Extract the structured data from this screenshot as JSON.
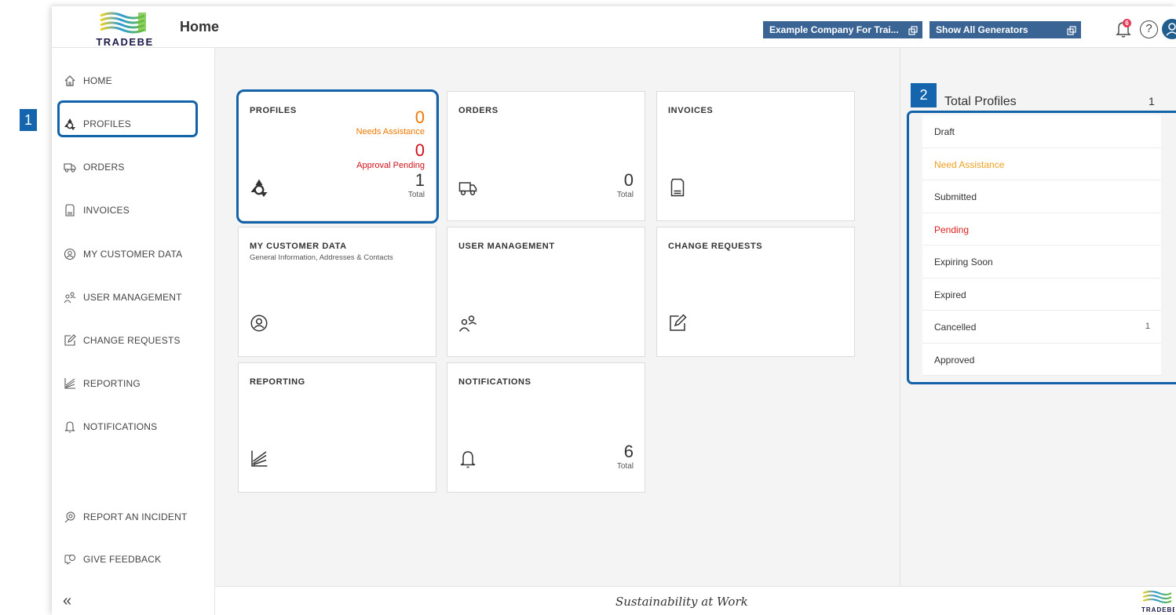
{
  "header": {
    "brand_word": "TRADEBE",
    "page_title": "Home",
    "company_button": "Example Company For Trai...",
    "generators_button": "Show All Generators",
    "notification_badge": "6",
    "help_label": "?"
  },
  "sidebar": {
    "items": [
      {
        "label": "HOME",
        "icon": "home-icon"
      },
      {
        "label": "PROFILES",
        "icon": "recycle-icon"
      },
      {
        "label": "ORDERS",
        "icon": "truck-icon"
      },
      {
        "label": "INVOICES",
        "icon": "document-icon"
      },
      {
        "label": "MY CUSTOMER DATA",
        "icon": "user-circle-icon"
      },
      {
        "label": "USER MANAGEMENT",
        "icon": "users-icon"
      },
      {
        "label": "CHANGE REQUESTS",
        "icon": "edit-icon"
      },
      {
        "label": "REPORTING",
        "icon": "chart-icon"
      },
      {
        "label": "NOTIFICATIONS",
        "icon": "bell-icon"
      }
    ],
    "bottom_items": [
      {
        "label": "REPORT AN INCIDENT",
        "icon": "incident-icon"
      },
      {
        "label": "GIVE FEEDBACK",
        "icon": "feedback-icon"
      }
    ],
    "collapse_glyph": "«"
  },
  "tiles": {
    "profiles": {
      "title": "PROFILES",
      "needs_assistance_value": "0",
      "needs_assistance_label": "Needs Assistance",
      "approval_pending_value": "0",
      "approval_pending_label": "Approval Pending",
      "total_value": "1",
      "total_label": "Total"
    },
    "orders": {
      "title": "ORDERS",
      "total_value": "0",
      "total_label": "Total"
    },
    "invoices": {
      "title": "INVOICES"
    },
    "customer_data": {
      "title": "MY CUSTOMER DATA",
      "subtitle": "General Information, Addresses & Contacts"
    },
    "user_management": {
      "title": "USER MANAGEMENT"
    },
    "change_requests": {
      "title": "CHANGE REQUESTS"
    },
    "reporting": {
      "title": "REPORTING"
    },
    "notifications": {
      "title": "NOTIFICATIONS",
      "total_value": "6",
      "total_label": "Total"
    }
  },
  "right_panel": {
    "title": "Total Profiles",
    "total": "1",
    "rows": [
      {
        "label": "Draft",
        "count": "",
        "color": "#333333"
      },
      {
        "label": "Need Assistance",
        "count": "",
        "color": "#f0a020"
      },
      {
        "label": "Submitted",
        "count": "",
        "color": "#333333"
      },
      {
        "label": "Pending",
        "count": "",
        "color": "#e02020"
      },
      {
        "label": "Expiring Soon",
        "count": "",
        "color": "#333333"
      },
      {
        "label": "Expired",
        "count": "",
        "color": "#333333"
      },
      {
        "label": "Cancelled",
        "count": "1",
        "color": "#333333"
      },
      {
        "label": "Approved",
        "count": "",
        "color": "#333333"
      }
    ]
  },
  "footer": {
    "tagline": "Sustainability at Work",
    "brand_word": "TRADEBE"
  },
  "callouts": [
    "1",
    "2"
  ],
  "colors": {
    "accent": "#3a6494",
    "highlight": "#1162a8",
    "needs_assistance": "#f07800",
    "approval_pending": "#d0101a"
  }
}
